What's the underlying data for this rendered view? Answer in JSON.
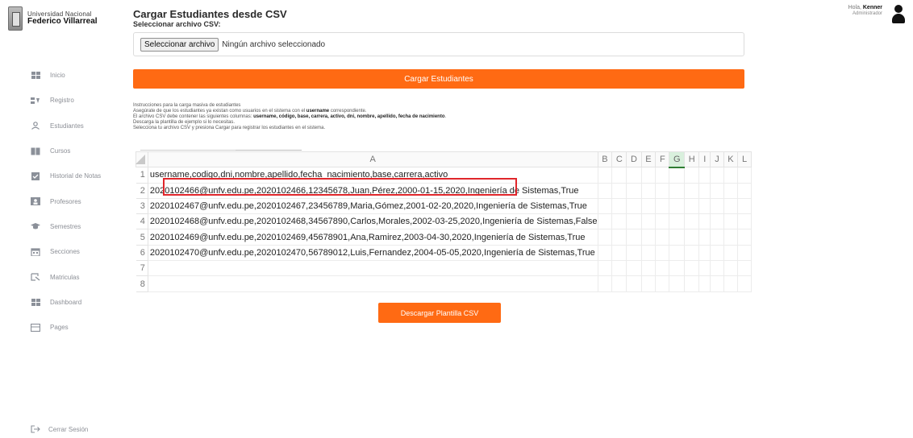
{
  "brand": {
    "line1": "Universidad Nacional",
    "line2": "Federico Villarreal"
  },
  "sidebar": {
    "items": [
      {
        "label": "Inicio",
        "icon": "grid-icon"
      },
      {
        "label": "Registro",
        "icon": "registro-icon"
      },
      {
        "label": "Estudiantes",
        "icon": "user-icon"
      },
      {
        "label": "Cursos",
        "icon": "book-icon"
      },
      {
        "label": "Historial de Notas",
        "icon": "check-square-icon"
      },
      {
        "label": "Profesores",
        "icon": "teacher-icon"
      },
      {
        "label": "Semestres",
        "icon": "graduation-cap-icon"
      },
      {
        "label": "Secciones",
        "icon": "calendar-icon"
      },
      {
        "label": "Matriculas",
        "icon": "enroll-icon"
      },
      {
        "label": "Dashboard",
        "icon": "dashboard-icon"
      },
      {
        "label": "Pages",
        "icon": "pages-icon"
      }
    ],
    "logout": "Cerrar Sesión"
  },
  "user": {
    "greeting": "Hola,",
    "name": "Kenner",
    "role": "Administrador"
  },
  "main": {
    "title": "Cargar Estudiantes desde CSV",
    "subtitle": "Seleccionar archivo CSV:",
    "file_button": "Seleccionar archivo",
    "file_status": "Ningún archivo seleccionado",
    "load_button": "Cargar Estudiantes",
    "instructions": {
      "l1": "Instrucciones para la carga masiva de estudiantes",
      "l2_a": "Asegúrate de que los estudiantes ya existan como usuarios en el sistema con el ",
      "l2_b": "username",
      "l2_c": " correspondiente.",
      "l3_a": "El archivo CSV debe contener las siguientes columnas: ",
      "l3_b": "username, código, base, carrera, activo, dni, nombre, apellido, fecha de nacimiento",
      "l3_c": ".",
      "l4": "Descarga la plantilla de ejemplo si lo necesitas.",
      "l5": "Selecciona tu archivo CSV y presiona Cargar para registrar los estudiantes en el sistema."
    },
    "download_button": "Descargar Plantilla CSV"
  },
  "sheet": {
    "columns": [
      "A",
      "B",
      "C",
      "D",
      "E",
      "F",
      "G",
      "H",
      "I",
      "J",
      "K",
      "L"
    ],
    "selected_column": "G",
    "row_numbers": [
      "1",
      "2",
      "3",
      "4",
      "5",
      "6",
      "7",
      "8"
    ],
    "rows": [
      "username,codigo,dni,nombre,apellido,fecha_nacimiento,base,carrera,activo",
      "2020102466@unfv.edu.pe,2020102466,12345678,Juan,Pérez,2000-01-15,2020,Ingeniería de Sistemas,True",
      "2020102467@unfv.edu.pe,2020102467,23456789,Maria,Gómez,2001-02-20,2020,Ingeniería de Sistemas,True",
      "2020102468@unfv.edu.pe,2020102468,34567890,Carlos,Morales,2002-03-25,2020,Ingeniería de Sistemas,False",
      "2020102469@unfv.edu.pe,2020102469,45678901,Ana,Ramirez,2003-04-30,2020,Ingeniería de Sistemas,True",
      "2020102470@unfv.edu.pe,2020102470,56789012,Luis,Fernandez,2004-05-05,2020,Ingeniería de Sistemas,True",
      "",
      ""
    ]
  },
  "colors": {
    "accent": "#ff6a13",
    "highlight": "#e0262b",
    "selected_column": "#d9f0dd"
  }
}
